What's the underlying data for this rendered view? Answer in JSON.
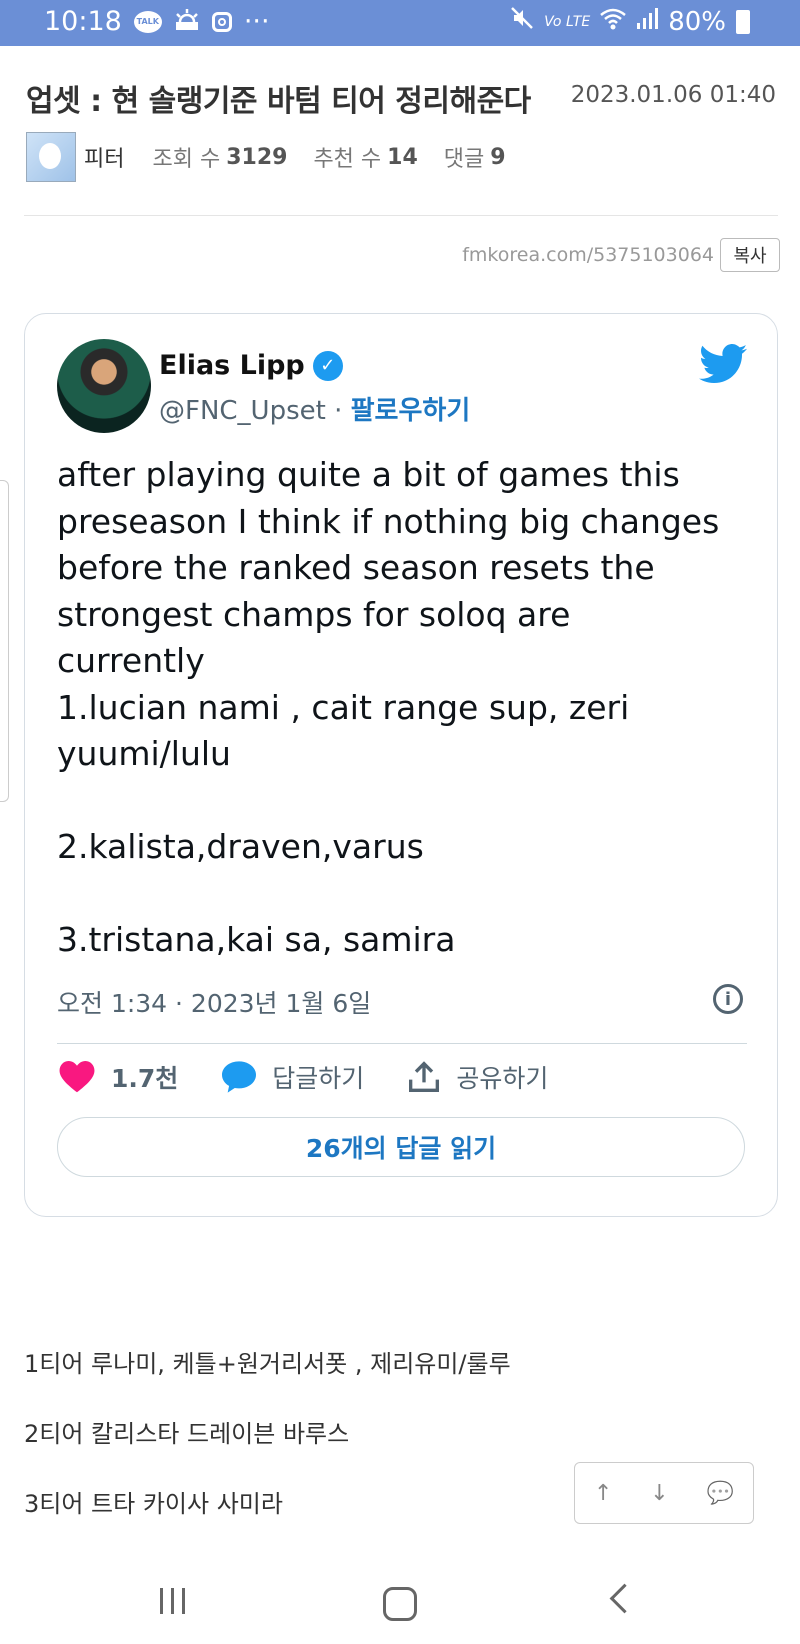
{
  "status_bar": {
    "time": "10:18",
    "talk_label": "TALK",
    "more": "···",
    "network": "Vo LTE",
    "battery": "80%"
  },
  "post": {
    "title": "업셋 : 현 솔랭기준 바텀 티어 정리해준다",
    "date": "2023.01.06 01:40",
    "author": "피터",
    "views_label": "조회 수",
    "views": "3129",
    "likes_label": "추천 수",
    "likes": "14",
    "comments_label": "댓글",
    "comments": "9",
    "url": "fmkorea.com/5375103064",
    "copy_label": "복사"
  },
  "tweet": {
    "name": "Elias Lipp",
    "handle": "@FNC_Upset",
    "separator": " · ",
    "follow_label": "팔로우하기",
    "text": "after playing quite a bit of games this\npreseason I think if nothing big changes\nbefore the ranked season resets the\nstrongest champs for soloq are\ncurrently\n1.lucian nami , cait range sup, zeri\nyuumi/lulu\n\n2.kalista,draven,varus\n\n3.tristana,kai sa, samira",
    "timestamp": "오전 1:34 · 2023년 1월 6일",
    "info_glyph": "i",
    "likes": "1.7천",
    "reply_label": "답글하기",
    "share_label": "공유하기",
    "read_replies_label": "26개의 답글 읽기"
  },
  "body_lines": [
    "1티어 루나미, 케틀+원거리서폿 , 제리유미/룰루",
    "2티어 칼리스타 드레이븐 바루스",
    "3티어 트타 카이사 사미라"
  ],
  "float_nav": {
    "up": "↑",
    "down": "↓",
    "comment": "💬"
  },
  "colors": {
    "status_bar": "#6b8fd6",
    "twitter_blue": "#1d9bf0",
    "link_blue": "#1d77c2",
    "heart_pink": "#f91880"
  }
}
